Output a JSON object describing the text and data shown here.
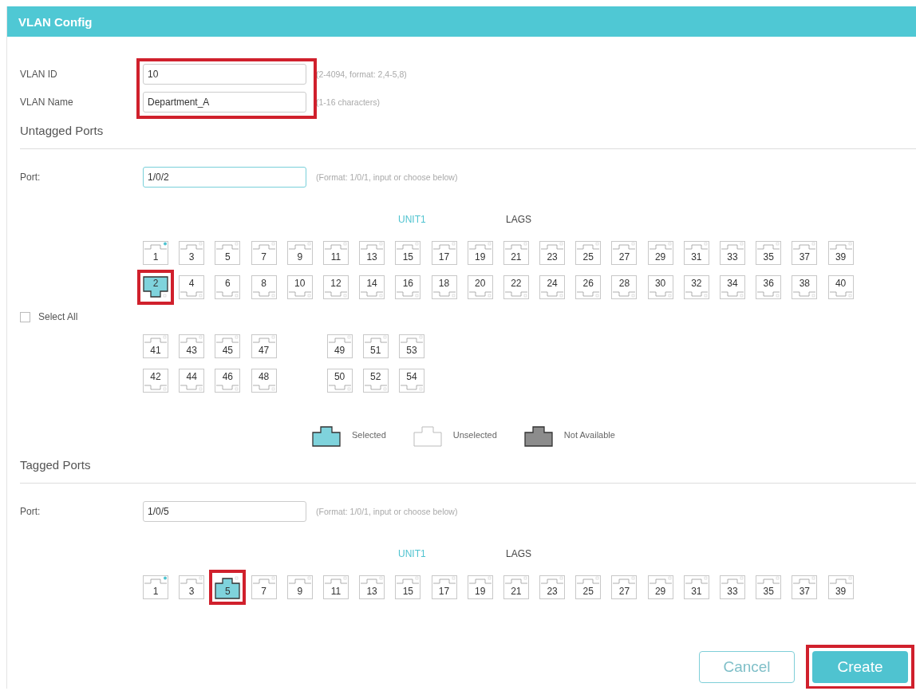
{
  "window": {
    "title": "VLAN Config"
  },
  "fields": {
    "highlighted": true,
    "items": [
      {
        "label": "VLAN ID",
        "value": "10",
        "hint": "(2-4094, format: 2,4-5,8)"
      },
      {
        "label": "VLAN Name",
        "value": "Department_A",
        "hint": "(1-16 characters)"
      }
    ]
  },
  "untagged": {
    "heading": "Untagged Ports",
    "port_label": "Port:",
    "port_value": "1/0/2",
    "port_focused": true,
    "port_hint": "(Format: 1/0/1, input or choose below)",
    "tabs": [
      {
        "label": "UNIT1",
        "selected": true
      },
      {
        "label": "LAGS",
        "selected": false
      }
    ],
    "select_all": {
      "label": "Select All",
      "checked": false
    },
    "groups": [
      {
        "top": [
          {
            "label": "1",
            "selected": false,
            "linked": true,
            "highlighted": false
          },
          {
            "label": "3",
            "selected": false,
            "linked": false,
            "highlighted": false
          },
          {
            "label": "5",
            "selected": false,
            "linked": false,
            "highlighted": false
          },
          {
            "label": "7",
            "selected": false,
            "linked": false,
            "highlighted": false
          },
          {
            "label": "9",
            "selected": false,
            "linked": false,
            "highlighted": false
          },
          {
            "label": "11",
            "selected": false,
            "linked": false,
            "highlighted": false
          },
          {
            "label": "13",
            "selected": false,
            "linked": false,
            "highlighted": false
          },
          {
            "label": "15",
            "selected": false,
            "linked": false,
            "highlighted": false
          },
          {
            "label": "17",
            "selected": false,
            "linked": false,
            "highlighted": false
          },
          {
            "label": "19",
            "selected": false,
            "linked": false,
            "highlighted": false
          },
          {
            "label": "21",
            "selected": false,
            "linked": false,
            "highlighted": false
          },
          {
            "label": "23",
            "selected": false,
            "linked": false,
            "highlighted": false
          },
          {
            "label": "25",
            "selected": false,
            "linked": false,
            "highlighted": false
          },
          {
            "label": "27",
            "selected": false,
            "linked": false,
            "highlighted": false
          },
          {
            "label": "29",
            "selected": false,
            "linked": false,
            "highlighted": false
          },
          {
            "label": "31",
            "selected": false,
            "linked": false,
            "highlighted": false
          },
          {
            "label": "33",
            "selected": false,
            "linked": false,
            "highlighted": false
          },
          {
            "label": "35",
            "selected": false,
            "linked": false,
            "highlighted": false
          },
          {
            "label": "37",
            "selected": false,
            "linked": false,
            "highlighted": false
          },
          {
            "label": "39",
            "selected": false,
            "linked": false,
            "highlighted": false
          }
        ],
        "bottom": [
          {
            "label": "2",
            "selected": true,
            "linked": false,
            "highlighted": true
          },
          {
            "label": "4",
            "selected": false,
            "linked": false,
            "highlighted": false
          },
          {
            "label": "6",
            "selected": false,
            "linked": false,
            "highlighted": false
          },
          {
            "label": "8",
            "selected": false,
            "linked": false,
            "highlighted": false
          },
          {
            "label": "10",
            "selected": false,
            "linked": false,
            "highlighted": false
          },
          {
            "label": "12",
            "selected": false,
            "linked": false,
            "highlighted": false
          },
          {
            "label": "14",
            "selected": false,
            "linked": false,
            "highlighted": false
          },
          {
            "label": "16",
            "selected": false,
            "linked": false,
            "highlighted": false
          },
          {
            "label": "18",
            "selected": false,
            "linked": false,
            "highlighted": false
          },
          {
            "label": "20",
            "selected": false,
            "linked": false,
            "highlighted": false
          },
          {
            "label": "22",
            "selected": false,
            "linked": false,
            "highlighted": false
          },
          {
            "label": "24",
            "selected": false,
            "linked": false,
            "highlighted": false
          },
          {
            "label": "26",
            "selected": false,
            "linked": false,
            "highlighted": false
          },
          {
            "label": "28",
            "selected": false,
            "linked": false,
            "highlighted": false
          },
          {
            "label": "30",
            "selected": false,
            "linked": false,
            "highlighted": false
          },
          {
            "label": "32",
            "selected": false,
            "linked": false,
            "highlighted": false
          },
          {
            "label": "34",
            "selected": false,
            "linked": false,
            "highlighted": false
          },
          {
            "label": "36",
            "selected": false,
            "linked": false,
            "highlighted": false
          },
          {
            "label": "38",
            "selected": false,
            "linked": false,
            "highlighted": false
          },
          {
            "label": "40",
            "selected": false,
            "linked": false,
            "highlighted": false
          }
        ]
      },
      {
        "top": [
          {
            "label": "41",
            "selected": false,
            "linked": false,
            "highlighted": false
          },
          {
            "label": "43",
            "selected": false,
            "linked": false,
            "highlighted": false
          },
          {
            "label": "45",
            "selected": false,
            "linked": false,
            "highlighted": false
          },
          {
            "label": "47",
            "selected": false,
            "linked": false,
            "highlighted": false
          }
        ],
        "bottom": [
          {
            "label": "42",
            "selected": false,
            "linked": false,
            "highlighted": false
          },
          {
            "label": "44",
            "selected": false,
            "linked": false,
            "highlighted": false
          },
          {
            "label": "46",
            "selected": false,
            "linked": false,
            "highlighted": false
          },
          {
            "label": "48",
            "selected": false,
            "linked": false,
            "highlighted": false
          }
        ]
      },
      {
        "top": [
          {
            "label": "49",
            "selected": false,
            "linked": false,
            "highlighted": false
          },
          {
            "label": "51",
            "selected": false,
            "linked": false,
            "highlighted": false
          },
          {
            "label": "53",
            "selected": false,
            "linked": false,
            "highlighted": false
          }
        ],
        "bottom": [
          {
            "label": "50",
            "selected": false,
            "linked": false,
            "highlighted": false
          },
          {
            "label": "52",
            "selected": false,
            "linked": false,
            "highlighted": false
          },
          {
            "label": "54",
            "selected": false,
            "linked": false,
            "highlighted": false
          }
        ]
      }
    ],
    "legend": [
      {
        "kind": "selected",
        "label": "Selected"
      },
      {
        "kind": "unselected",
        "label": "Unselected"
      },
      {
        "kind": "unavailable",
        "label": "Not Available"
      }
    ]
  },
  "tagged": {
    "heading": "Tagged Ports",
    "port_label": "Port:",
    "port_value": "1/0/5",
    "port_focused": false,
    "port_hint": "(Format: 1/0/1, input or choose below)",
    "tabs": [
      {
        "label": "UNIT1",
        "selected": true
      },
      {
        "label": "LAGS",
        "selected": false
      }
    ],
    "groups": [
      {
        "top": [
          {
            "label": "1",
            "selected": false,
            "linked": true,
            "highlighted": false
          },
          {
            "label": "3",
            "selected": false,
            "linked": false,
            "highlighted": false
          },
          {
            "label": "5",
            "selected": true,
            "linked": false,
            "highlighted": true
          },
          {
            "label": "7",
            "selected": false,
            "linked": false,
            "highlighted": false
          },
          {
            "label": "9",
            "selected": false,
            "linked": false,
            "highlighted": false
          },
          {
            "label": "11",
            "selected": false,
            "linked": false,
            "highlighted": false
          },
          {
            "label": "13",
            "selected": false,
            "linked": false,
            "highlighted": false
          },
          {
            "label": "15",
            "selected": false,
            "linked": false,
            "highlighted": false
          },
          {
            "label": "17",
            "selected": false,
            "linked": false,
            "highlighted": false
          },
          {
            "label": "19",
            "selected": false,
            "linked": false,
            "highlighted": false
          },
          {
            "label": "21",
            "selected": false,
            "linked": false,
            "highlighted": false
          },
          {
            "label": "23",
            "selected": false,
            "linked": false,
            "highlighted": false
          },
          {
            "label": "25",
            "selected": false,
            "linked": false,
            "highlighted": false
          },
          {
            "label": "27",
            "selected": false,
            "linked": false,
            "highlighted": false
          },
          {
            "label": "29",
            "selected": false,
            "linked": false,
            "highlighted": false
          },
          {
            "label": "31",
            "selected": false,
            "linked": false,
            "highlighted": false
          },
          {
            "label": "33",
            "selected": false,
            "linked": false,
            "highlighted": false
          },
          {
            "label": "35",
            "selected": false,
            "linked": false,
            "highlighted": false
          },
          {
            "label": "37",
            "selected": false,
            "linked": false,
            "highlighted": false
          },
          {
            "label": "39",
            "selected": false,
            "linked": false,
            "highlighted": false
          }
        ]
      }
    ]
  },
  "buttons": [
    {
      "kind": "secondary",
      "label": "Cancel",
      "highlighted": false
    },
    {
      "kind": "primary",
      "label": "Create",
      "highlighted": true
    }
  ]
}
